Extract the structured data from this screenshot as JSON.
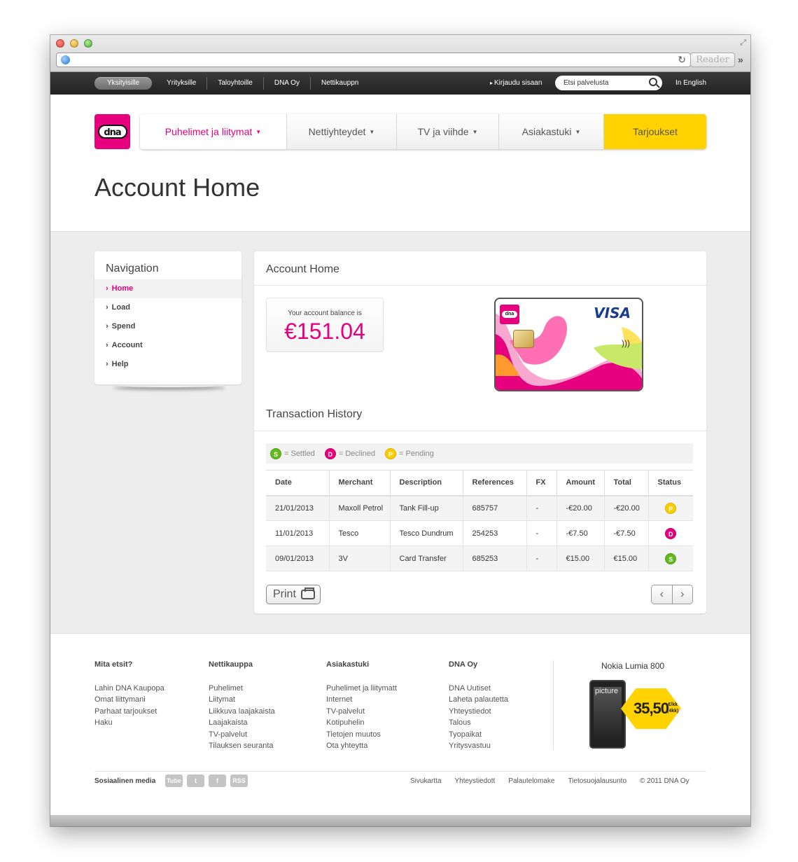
{
  "browser": {
    "reader_label": "Reader"
  },
  "topbar": {
    "items": [
      "Yksityisille",
      "Yrityksille",
      "Taloyhtoille",
      "DNA Oy",
      "Nettikauppn"
    ],
    "login": "Kirjaudu sisaan",
    "search_placeholder": "Etsi palvelusta",
    "english": "In English"
  },
  "logo_text": "dna",
  "mainnav": {
    "items": [
      "Puhelimet ja liitymat",
      "Nettiyhteydet",
      "TV ja viihde",
      "Asiakastuki"
    ],
    "offers": "Tarjoukset"
  },
  "page_title": "Account Home",
  "sidebar": {
    "title": "Navigation",
    "items": [
      "Home",
      "Load",
      "Spend",
      "Account",
      "Help"
    ]
  },
  "main": {
    "title": "Account Home",
    "balance_label": "Your account balance is",
    "balance_value": "€151.04",
    "card_brand": "VISA",
    "history_title": "Transaction History",
    "legend": {
      "settled": "= Settled",
      "declined": "= Declined",
      "pending": "= Pending"
    },
    "columns": [
      "Date",
      "Merchant",
      "Description",
      "References",
      "FX",
      "Amount",
      "Total",
      "Status"
    ],
    "rows": [
      {
        "date": "21/01/2013",
        "merchant": "Maxoll Petrol",
        "description": "Tank Fill-up",
        "ref": "685757",
        "fx": "-",
        "amount": "-€20.00",
        "total": "-€20.00",
        "status": "P"
      },
      {
        "date": "11/01/2013",
        "merchant": "Tesco",
        "description": "Tesco Dundrum",
        "ref": "254253",
        "fx": "-",
        "amount": "-€7.50",
        "total": "-€7.50",
        "status": "D"
      },
      {
        "date": "09/01/2013",
        "merchant": "3V",
        "description": "Card Transfer",
        "ref": "685253",
        "fx": "-",
        "amount": "€15.00",
        "total": "€15.00",
        "status": "S"
      }
    ],
    "print_label": "Print"
  },
  "footer": {
    "cols": [
      {
        "title": "Mita etsit?",
        "links": [
          "Lahin DNA Kaupopa",
          "Omat liittymani",
          "Parhaat tarjoukset",
          "Haku"
        ]
      },
      {
        "title": "Nettikauppa",
        "links": [
          "Puhelimet",
          "Liitymat",
          "Liikkuva laajakaista",
          "Laajakaista",
          "TV-palvelut",
          "Tilauksen seuranta"
        ]
      },
      {
        "title": "Asiakastuki",
        "links": [
          "Puhelimet ja liitymatt",
          "Internet",
          "TV-palvelut",
          "Kotipuhelin",
          "Tietojen muutos",
          "Ota yhteytta"
        ]
      },
      {
        "title": "DNA Oy",
        "links": [
          "DNA Uutiset",
          "Laheta palautetta",
          "Yhteystiedot",
          "Talous",
          "Tyopaikat",
          "Yritysvastuu"
        ]
      }
    ],
    "promo": {
      "title": "Nokia Lumia 800",
      "price": "35,50",
      "unit_top": "€/kk",
      "unit_bottom": "(4kk)",
      "screen_text": "picture"
    },
    "social_label": "Sosiaalinen media",
    "social": [
      "Tube",
      "t",
      "f",
      "RSS"
    ],
    "links": [
      "Sivukartta",
      "Yhteystiedott",
      "Palautelomake",
      "Tietosuojalausunto",
      "© 2011 DNA Oy"
    ]
  },
  "colors": {
    "brand": "#e6007e",
    "offer": "#ffd200",
    "settled": "#64b91e",
    "pending": "#ffcc00"
  }
}
